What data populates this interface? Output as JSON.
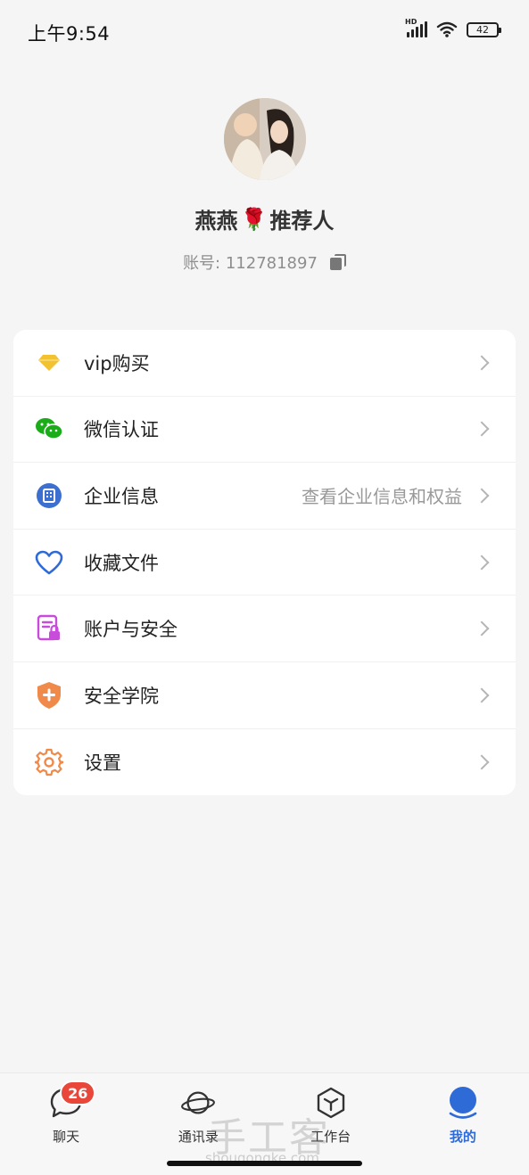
{
  "status_bar": {
    "time": "上午9:54",
    "network": "HD",
    "battery": "42"
  },
  "profile": {
    "name": "燕燕",
    "name_suffix": "推荐人",
    "account_label": "账号: 112781897"
  },
  "menu": [
    {
      "id": "vip",
      "label": "vip购买",
      "icon": "diamond-icon",
      "hint": ""
    },
    {
      "id": "wechat",
      "label": "微信认证",
      "icon": "wechat-icon",
      "hint": ""
    },
    {
      "id": "company",
      "label": "企业信息",
      "icon": "building-icon",
      "hint": "查看企业信息和权益"
    },
    {
      "id": "favorites",
      "label": "收藏文件",
      "icon": "heart-icon",
      "hint": ""
    },
    {
      "id": "account-security",
      "label": "账户与安全",
      "icon": "document-lock-icon",
      "hint": ""
    },
    {
      "id": "security-academy",
      "label": "安全学院",
      "icon": "shield-icon",
      "hint": ""
    },
    {
      "id": "settings",
      "label": "设置",
      "icon": "gear-icon",
      "hint": ""
    }
  ],
  "tabs": [
    {
      "id": "chat",
      "label": "聊天",
      "badge": "26",
      "active": false
    },
    {
      "id": "contacts",
      "label": "通讯录",
      "active": false
    },
    {
      "id": "workbench",
      "label": "工作台",
      "active": false
    },
    {
      "id": "me",
      "label": "我的",
      "active": true
    }
  ],
  "watermark": {
    "text": "手工客",
    "sub": "shougongke.com"
  },
  "colors": {
    "accent": "#2f6bd6",
    "badge": "#e8473a",
    "wechat": "#1aad19",
    "vip": "#f2c230",
    "shield": "#f08a4b",
    "gear": "#f08a4b",
    "doc": "#c84bdc"
  }
}
